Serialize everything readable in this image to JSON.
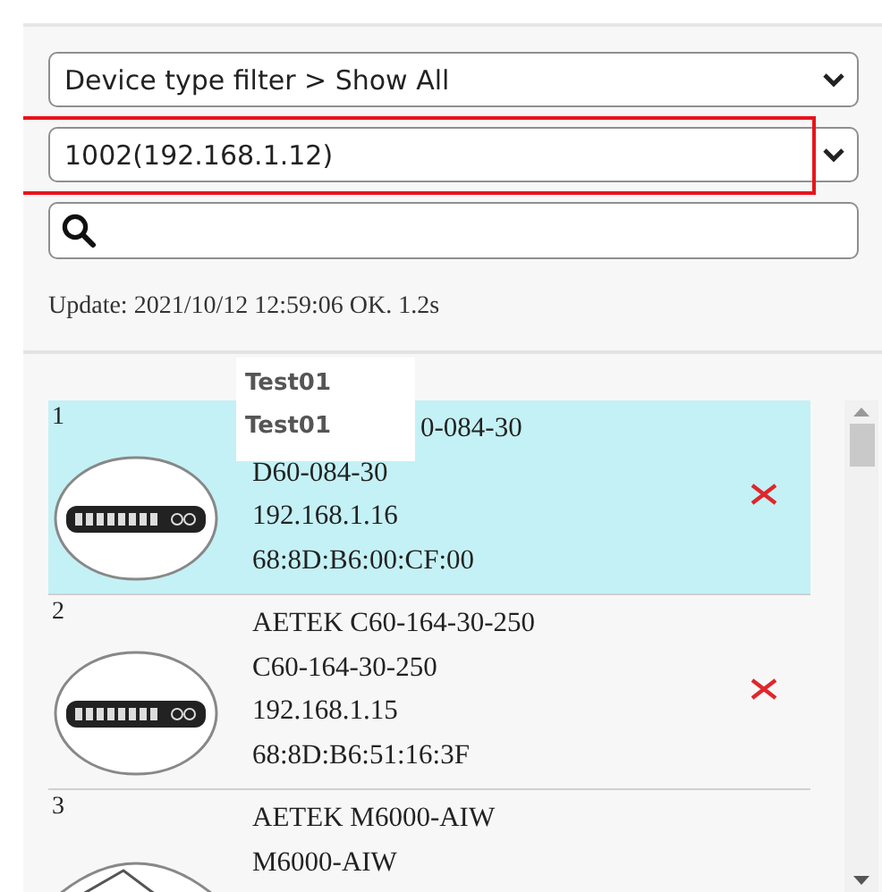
{
  "filters": [
    {
      "kind": "select",
      "value": "Device type filter > Show All",
      "highlighted": false
    },
    {
      "kind": "select",
      "value": "1002(192.168.1.12)",
      "highlighted": true
    },
    {
      "kind": "search"
    }
  ],
  "update_status": "Update: 2021/10/12 12:59:06 OK. 1.2s",
  "tooltip": [
    "Test01",
    "Test01"
  ],
  "devices": [
    {
      "number": "1",
      "selected": true,
      "kind": "switch",
      "lines": [
        "0-084-30",
        "D60-084-30",
        "192.168.1.16",
        "68:8D:B6:00:CF:00"
      ],
      "title_covered": true,
      "removable": true
    },
    {
      "number": "2",
      "selected": false,
      "kind": "switch",
      "lines": [
        "AETEK C60-164-30-250",
        "C60-164-30-250",
        "192.168.1.15",
        "68:8D:B6:51:16:3F"
      ],
      "removable": true
    },
    {
      "number": "3",
      "selected": false,
      "kind": "antenna",
      "lines": [
        "AETEK M6000-AIW",
        "M6000-AIW"
      ],
      "removable": false
    }
  ]
}
